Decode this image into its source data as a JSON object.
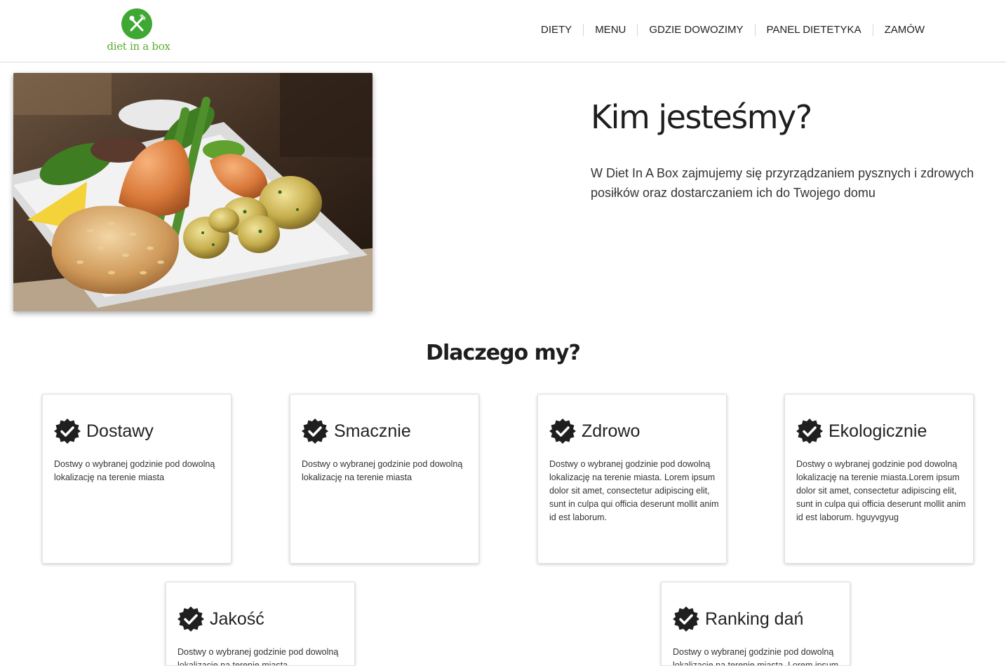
{
  "brand": {
    "name": "diet in a box",
    "accent": "#3ea833"
  },
  "nav": {
    "items": [
      "DIETY",
      "MENU",
      "GDZIE DOWOZIMY",
      "PANEL DIETETYKA",
      "ZAMÓW"
    ]
  },
  "hero": {
    "title": "Kim jesteśmy?",
    "text": "W Diet In A Box zajmujemy się przyrządzaniem pysznych i zdrowych posiłków oraz dostarczaniem ich do Twojego domu",
    "image": "food-plate-photo"
  },
  "why": {
    "title": "Dlaczego my?",
    "icon": "check-badge-icon",
    "cards": [
      {
        "title": "Dostawy",
        "text": "Dostwy o wybranej godzinie pod dowolną lokalizację na terenie miasta"
      },
      {
        "title": "Smacznie",
        "text": "Dostwy o wybranej godzinie pod dowolną lokalizację na terenie miasta"
      },
      {
        "title": "Zdrowo",
        "text": "Dostwy o wybranej godzinie pod dowolną lokalizację na terenie miasta. Lorem ipsum dolor sit amet, consectetur adipiscing elit, sunt in culpa qui officia deserunt mollit anim id est laborum."
      },
      {
        "title": "Ekologicznie",
        "text": "Dostwy o wybranej godzinie pod dowolną lokalizację na terenie miasta.Lorem ipsum dolor sit amet, consectetur adipiscing elit, sunt in culpa qui officia deserunt mollit anim id est laborum. hguyvgyug"
      },
      {
        "title": "Jakość",
        "text": "Dostwy o wybranej godzinie pod dowolną lokalizację na terenie miasta"
      },
      {
        "title": "Ranking dań",
        "text": "Dostwy o wybranej godzinie pod dowolną lokalizację na terenie miasta. Lorem ipsum"
      }
    ]
  }
}
